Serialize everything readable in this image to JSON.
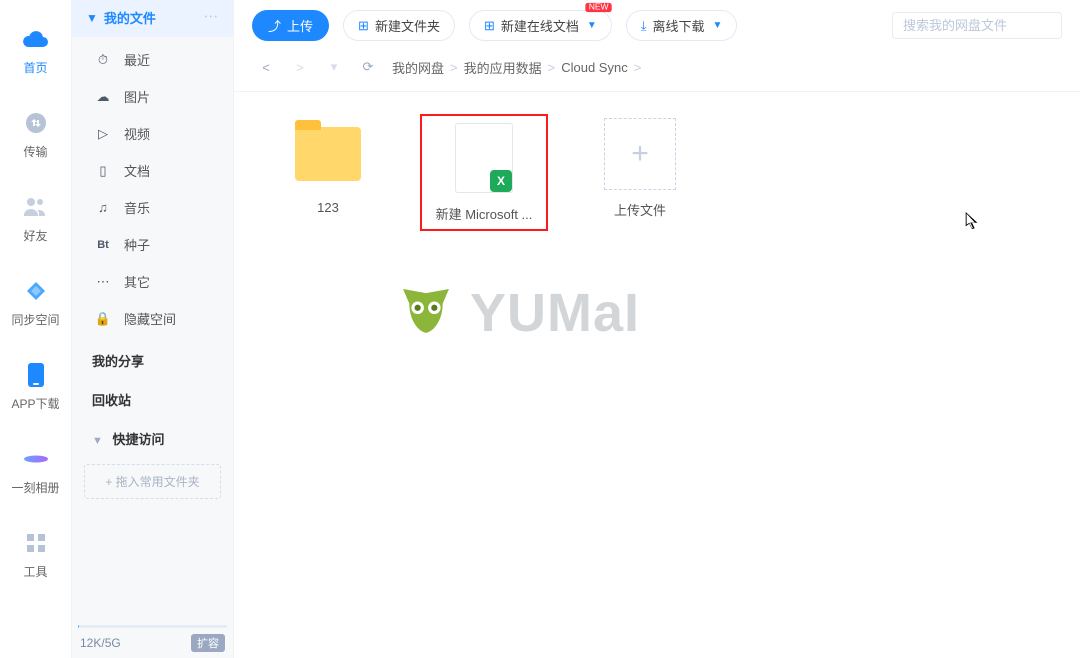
{
  "nav": [
    {
      "id": "home",
      "label": "首页",
      "active": true
    },
    {
      "id": "xfer",
      "label": "传输",
      "active": false
    },
    {
      "id": "friend",
      "label": "好友",
      "active": false
    },
    {
      "id": "sync",
      "label": "同步空间",
      "active": false
    },
    {
      "id": "app",
      "label": "APP下载",
      "active": false
    },
    {
      "id": "album",
      "label": "一刻相册",
      "active": false
    },
    {
      "id": "tools",
      "label": "工具",
      "active": false
    }
  ],
  "sidebar": {
    "header": {
      "title": "我的文件"
    },
    "items": [
      {
        "id": "recent",
        "label": "最近"
      },
      {
        "id": "photo",
        "label": "图片"
      },
      {
        "id": "video",
        "label": "视频"
      },
      {
        "id": "doc",
        "label": "文档"
      },
      {
        "id": "music",
        "label": "音乐"
      },
      {
        "id": "bt",
        "label": "种子"
      },
      {
        "id": "other",
        "label": "其它"
      },
      {
        "id": "hidden",
        "label": "隐藏空间"
      }
    ],
    "share": "我的分享",
    "recycle": "回收站",
    "quick": {
      "title": "快捷访问",
      "placeholder": "+ 拖入常用文件夹"
    },
    "quota": {
      "used": "12K",
      "total": "5G",
      "expand": "扩容"
    }
  },
  "toolbar": {
    "upload": "上传",
    "newfolder": "新建文件夹",
    "newdoc": "新建在线文档",
    "newdoc_badge": "NEW",
    "offline": "离线下载"
  },
  "search": {
    "placeholder": "搜索我的网盘文件"
  },
  "breadcrumb": {
    "items": [
      "我的网盘",
      "我的应用数据",
      "Cloud Sync"
    ]
  },
  "files": [
    {
      "name": "123",
      "type": "folder",
      "selected": false
    },
    {
      "name": "新建 Microsoft ...",
      "type": "excel",
      "selected": true
    },
    {
      "name": "上传文件",
      "type": "upload",
      "selected": false
    }
  ],
  "watermark": "YUMaI"
}
